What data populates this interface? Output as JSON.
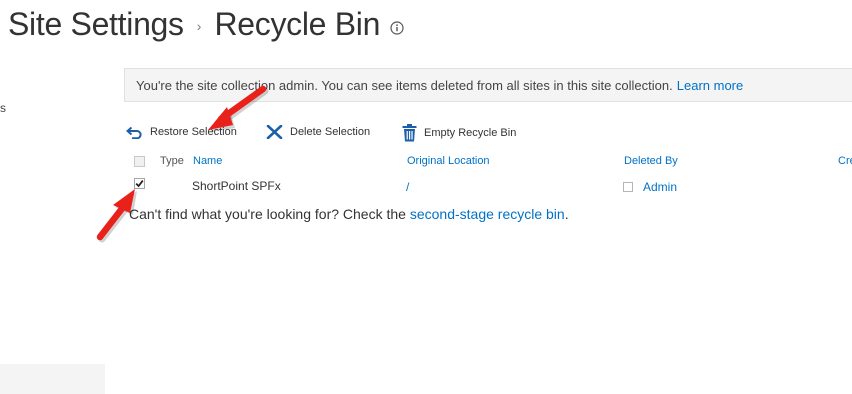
{
  "header": {
    "breadcrumb_root": "Site Settings",
    "breadcrumb_separator": "›",
    "page_title": "Recycle Bin",
    "info_icon": "info-icon"
  },
  "left_nav": {
    "fragment_text": "s"
  },
  "info_bar": {
    "message": "You're the site collection admin. You can see items deleted from all sites in this site collection.",
    "link_text": "Learn more"
  },
  "toolbar": {
    "restore_label": "Restore Selection",
    "delete_label": "Delete Selection",
    "empty_label": "Empty Recycle Bin"
  },
  "table": {
    "columns": {
      "type": "Type",
      "name": "Name",
      "original_location": "Original Location",
      "deleted_by": "Deleted By",
      "created": "Cre"
    },
    "rows": [
      {
        "checked": true,
        "name": "ShortPoint SPFx",
        "original_location": "/",
        "deleted_by": "Admin"
      }
    ]
  },
  "footer": {
    "prefix": "Can't find what you're looking for? Check the",
    "link_text": "second-stage recycle bin",
    "suffix": "."
  },
  "colors": {
    "link": "#0072c6",
    "annotation_arrow": "#e8221b",
    "info_bar_bg": "#f4f4f4"
  }
}
